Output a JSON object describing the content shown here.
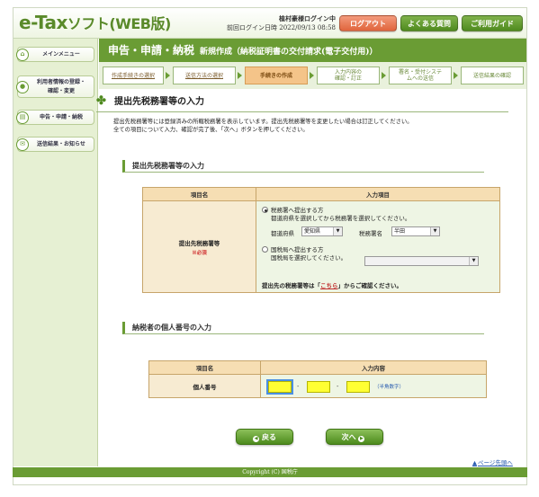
{
  "header": {
    "logo_main": "e-Tax",
    "logo_sub": "ソフト(WEB版)",
    "user_name": "植村豪様ログイン中",
    "last_login_label": "前回ログイン日時",
    "last_login_time": "2022/09/13 08:58",
    "logout_label": "ログアウト",
    "faq_label": "よくある質問",
    "guide_label": "ご利用ガイド"
  },
  "sidebar": {
    "items": [
      {
        "label": "メインメニュー",
        "icon": "home-icon"
      },
      {
        "label_1": "利用者情報の登録・",
        "label_2": "確認・変更",
        "icon": "user-icon"
      },
      {
        "label": "申告・申請・納税",
        "icon": "document-icon"
      },
      {
        "label": "送信結果・お知らせ",
        "icon": "mail-icon"
      }
    ]
  },
  "title": {
    "main": "申告・申請・納税",
    "sub": "新規作成（納税証明書の交付請求(電子交付用)）"
  },
  "steps": [
    {
      "label": "作成手続きの選択",
      "state": "done"
    },
    {
      "label": "送信方法の選択",
      "state": "done"
    },
    {
      "label": "手続きの作成",
      "state": "current"
    },
    {
      "label_1": "入力内容の",
      "label_2": "確認・訂正",
      "state": "todo"
    },
    {
      "label_1": "署名・受付システ",
      "label_2": "ムへの送信",
      "state": "todo"
    },
    {
      "label": "送信結果の確認",
      "state": "todo"
    }
  ],
  "page": {
    "heading": "提出先税務署等の入力",
    "desc_1": "提出先税務署等には登録済みの所轄税務署を表示しています。提出先税務署等を変更したい場合は訂正してください。",
    "desc_2": "全ての項目について入力、確認が完了後、「次へ」ボタンを押してください。"
  },
  "section1": {
    "heading": "提出先税務署等の入力",
    "col_name": "項目名",
    "col_input": "入力項目",
    "row_label": "提出先税務署等",
    "required": "※必須",
    "opt1_title": "税務署へ提出する方",
    "opt1_desc": "都道府県を選択してから税務署を選択してください。",
    "pref_label": "都道府県",
    "pref_value": "愛知県",
    "office_label": "税務署名",
    "office_value": "半田",
    "opt2_title": "国税局へ提出する方",
    "opt2_desc": "国税局を選択してください。",
    "bureau_value": "",
    "confirm_pre": "提出先の税務署等は「",
    "confirm_link": "こちら",
    "confirm_post": "」からご確認ください。"
  },
  "section2": {
    "heading": "納税者の個人番号の入力",
    "col_name": "項目名",
    "col_input": "入力内容",
    "row_label": "個人番号",
    "part1": "",
    "part2": "",
    "part3": "",
    "half_width_note": "（半角数字）"
  },
  "buttons": {
    "back": "戻る",
    "next": "次へ"
  },
  "page_top": "ページ先頭へ",
  "footer": "Copyright (C) 国税庁",
  "colors": {
    "brand_green": "#6a9c34",
    "current_step": "#f4c489",
    "logout": "#e0653d",
    "input_highlight": "#ffff33"
  }
}
